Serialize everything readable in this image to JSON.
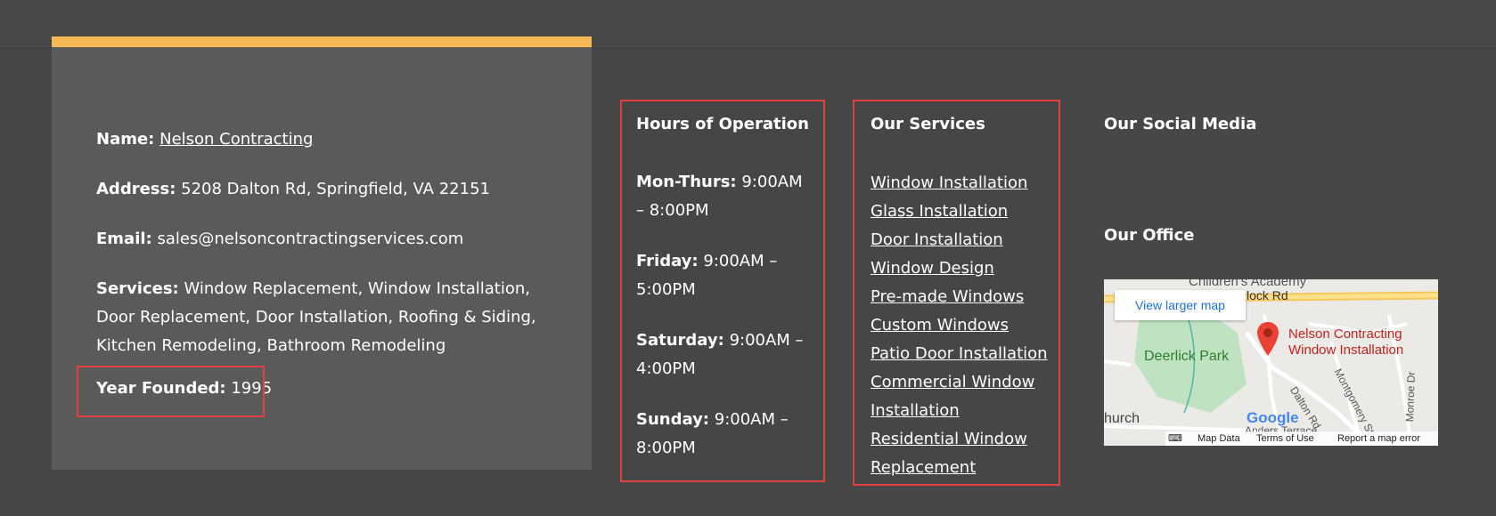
{
  "company": {
    "name_label": "Name:",
    "name_value": "Nelson Contracting",
    "address_label": "Address:",
    "address_value": "5208 Dalton Rd, Springfield, VA 22151",
    "email_label": "Email:",
    "email_value": "sales@nelsoncontractingservices.com",
    "services_label": "Services:",
    "services_value": "Window Replacement, Window Installation, Door Replacement, Door Installation, Roofing & Siding, Kitchen Remodeling, Bathroom Remodeling",
    "year_label": "Year Founded:",
    "year_value": "1995"
  },
  "hours": {
    "title": "Hours of Operation",
    "items": [
      {
        "day": "Mon-Thurs:",
        "time": "9:00AM – 8:00PM"
      },
      {
        "day": "Friday:",
        "time": "9:00AM – 5:00PM"
      },
      {
        "day": "Saturday:",
        "time": "9:00AM – 4:00PM"
      },
      {
        "day": "Sunday:",
        "time": "9:00AM – 8:00PM"
      }
    ]
  },
  "services": {
    "title": "Our Services",
    "links": [
      "Window Installation",
      "Glass Installation",
      "Door Installation",
      "Window Design",
      "Pre-made Windows",
      "Custom Windows",
      "Patio Door Installation",
      "Commercial Window Installation",
      "Residential Window Replacement"
    ]
  },
  "social": {
    "title": "Our Social Media"
  },
  "office": {
    "title": "Our Office",
    "map": {
      "view_larger": "View larger map",
      "pin_label_line1": "Nelson Contracting",
      "pin_label_line2": "Window Installation",
      "park": "Deerlick Park",
      "academy": "Children's Academy",
      "road_top": "lock Rd",
      "church": "hurch",
      "dalton": "Dalton Rd",
      "montgomery": "Montgomery St",
      "monroe": "Monroe Dr",
      "anders": "Anders Terrace",
      "google": "Google",
      "map_data": "Map Data",
      "terms": "Terms of Use",
      "report": "Report a map error"
    }
  },
  "colors": {
    "page_bg": "#474747",
    "card_bg": "#5a5a5a",
    "accent": "#f7b955",
    "highlight_border": "#e0413e",
    "pin": "#ea4335"
  }
}
